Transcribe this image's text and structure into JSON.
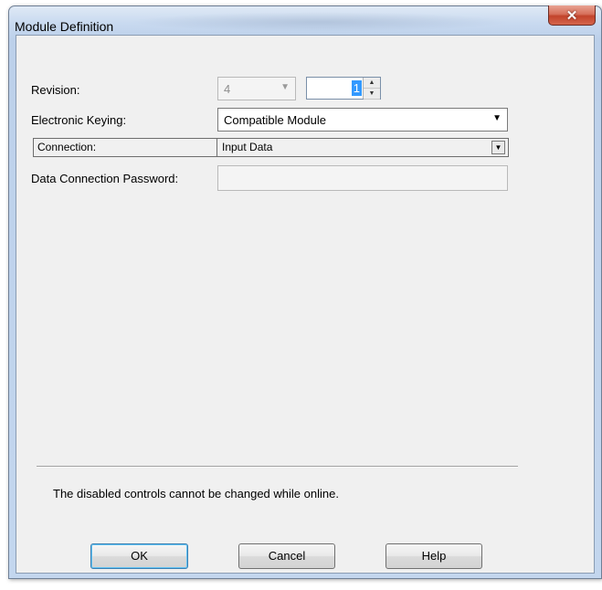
{
  "window": {
    "title": "Module Definition"
  },
  "form": {
    "revision_label": "Revision:",
    "revision_major": "4",
    "revision_minor": "1",
    "keying_label": "Electronic Keying:",
    "keying_value": "Compatible Module",
    "connection_label": "Connection:",
    "connection_value": "Input Data",
    "password_label": "Data Connection Password:",
    "password_value": ""
  },
  "status_message": "The disabled controls cannot be changed while online.",
  "buttons": {
    "ok": "OK",
    "cancel": "Cancel",
    "help": "Help"
  },
  "colors": {
    "accent": "#3399ff",
    "close": "#c2432b"
  }
}
